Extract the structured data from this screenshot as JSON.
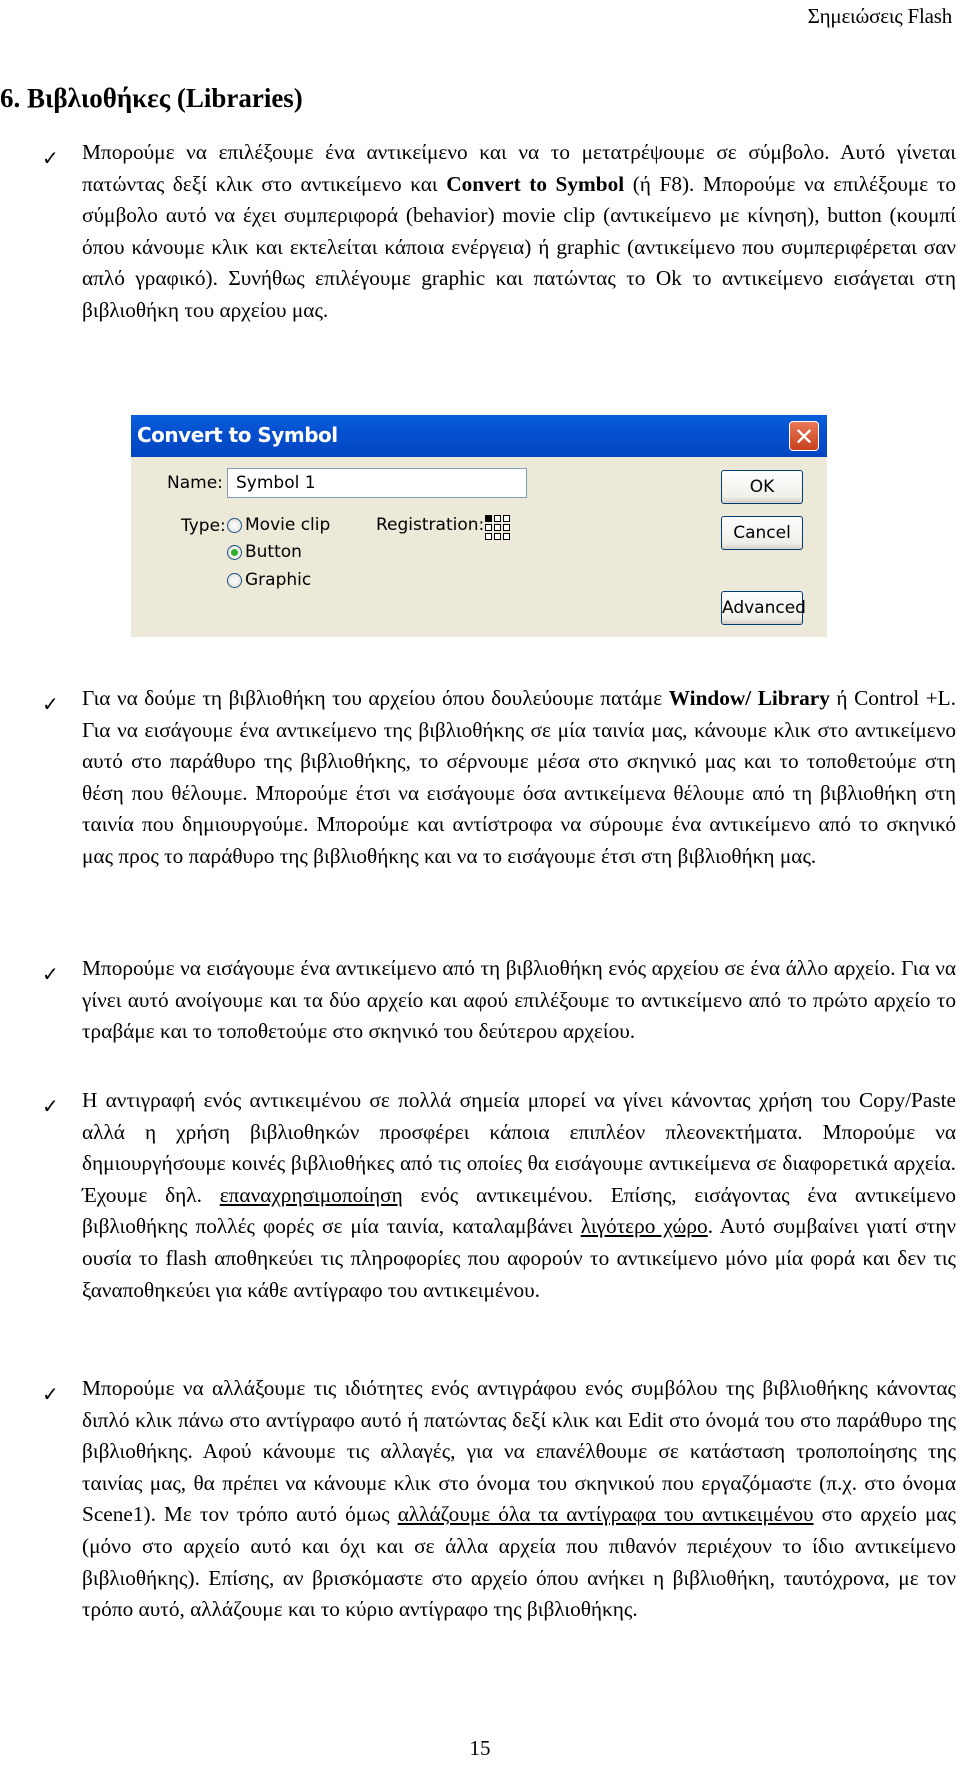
{
  "header": {
    "running_title": "Σημειώσεις Flash"
  },
  "section": {
    "title": "6. Βιβλιοθήκες (Libraries)"
  },
  "bullet_icon": "checkmark-icon",
  "paragraphs": [
    {
      "parts": [
        {
          "t": "Μπορούμε να επιλέξουμε ένα αντικείμενο και να το μετατρέψουμε σε σύμβολο. Αυτό γίνεται πατώντας δεξί κλικ στο αντικείμενο και "
        },
        {
          "t": "Convert to Symbol",
          "b": true
        },
        {
          "t": " (ή F8). Μπορούμε να επιλέξουμε το σύμβολο αυτό να έχει συμπεριφορά (behavior) movie clip (αντικείμενο με κίνηση), button (κουμπί όπου κάνουμε κλικ και εκτελείται κάποια ενέργεια) ή graphic (αντικείμενο που συμπεριφέρεται σαν απλό γραφικό). Συνήθως επιλέγουμε graphic και πατώντας το Ok το αντικείμενο εισάγεται στη βιβλιοθήκη του αρχείου μας."
        }
      ]
    },
    {
      "parts": [
        {
          "t": "Για να δούμε τη βιβλιοθήκη του αρχείου όπου δουλεύουμε πατάμε "
        },
        {
          "t": "Window/ Library",
          "b": true
        },
        {
          "t": " ή Control +L. Για να εισάγουμε ένα αντικείμενο της βιβλιοθήκης σε μία ταινία μας, κάνουμε κλικ στο αντικείμενο αυτό στο παράθυρο της βιβλιοθήκης, το σέρνουμε μέσα στο σκηνικό μας και το τοποθετούμε στη θέση που θέλουμε. Μπορούμε έτσι να εισάγουμε όσα αντικείμενα θέλουμε από τη βιβλιοθήκη στη ταινία που δημιουργούμε. Μπορούμε και αντίστροφα να σύρουμε ένα αντικείμενο από το σκηνικό μας προς το παράθυρο της βιβλιοθήκης και να το εισάγουμε έτσι στη βιβλιοθήκη μας."
        }
      ]
    },
    {
      "parts": [
        {
          "t": "Μπορούμε να εισάγουμε ένα αντικείμενο από τη βιβλιοθήκη ενός αρχείου σε ένα άλλο αρχείο. Για να γίνει αυτό ανοίγουμε και τα δύο αρχείο και αφού επιλέξουμε το αντικείμενο από το πρώτο αρχείο το τραβάμε και το τοποθετούμε στο σκηνικό του δεύτερου αρχείου."
        }
      ]
    },
    {
      "parts": [
        {
          "t": "Η αντιγραφή ενός αντικειμένου σε πολλά σημεία μπορεί να γίνει κάνοντας χρήση του Copy/Paste αλλά η χρήση βιβλιοθηκών προσφέρει κάποια επιπλέον πλεονεκτήματα. Μπορούμε να δημιουργήσουμε κοινές βιβλιοθήκες από τις οποίες θα εισάγουμε αντικείμενα σε διαφορετικά αρχεία. Έχουμε δηλ. "
        },
        {
          "t": "επαναχρησιμοποίηση",
          "u": true
        },
        {
          "t": " ενός αντικειμένου. Επίσης, εισάγοντας ένα αντικείμενο βιβλιοθήκης πολλές φορές σε μία ταινία, καταλαμβάνει "
        },
        {
          "t": "λιγότερο χώρο",
          "u": true
        },
        {
          "t": ". Αυτό συμβαίνει γιατί στην ουσία το flash αποθηκεύει τις πληροφορίες που αφορούν το αντικείμενο μόνο μία φορά και δεν τις ξαναποθηκεύει για κάθε αντίγραφο του αντικειμένου."
        }
      ]
    },
    {
      "parts": [
        {
          "t": "Μπορούμε να αλλάξουμε τις ιδιότητες ενός αντιγράφου ενός συμβόλου της βιβλιοθήκης κάνοντας διπλό κλικ πάνω στο αντίγραφο αυτό ή πατώντας δεξί κλικ και Edit στο όνομά του στο παράθυρο της βιβλιοθήκης. Αφού κάνουμε τις αλλαγές, για να επανέλθουμε σε κατάσταση τροποποίησης της ταινίας μας, θα πρέπει να κάνουμε κλικ στο όνομα του σκηνικού που εργαζόμαστε (π.χ. στο όνομα Scene1).  Με τον τρόπο αυτό όμως "
        },
        {
          "t": "αλλάζουμε όλα τα αντίγραφα του αντικειμένου",
          "u": true
        },
        {
          "t": " στο αρχείο μας (μόνο στο αρχείο αυτό και όχι και σε άλλα αρχεία που πιθανόν περιέχουν το ίδιο αντικείμενο βιβλιοθήκης). Επίσης, αν βρισκόμαστε στο αρχείο όπου ανήκει η βιβλιοθήκη, ταυτόχρονα, με τον τρόπο αυτό, αλλάζουμε και το κύριο αντίγραφο της βιβλιοθήκης."
        }
      ]
    }
  ],
  "dialog": {
    "title": "Convert to Symbol",
    "close_icon": "close-icon",
    "name_label": "Name:",
    "name_value": "Symbol 1",
    "type_label": "Type:",
    "type_options": [
      "Movie clip",
      "Button",
      "Graphic"
    ],
    "type_selected": "Button",
    "registration_label": "Registration:",
    "registration_selected": "top-left",
    "buttons": {
      "ok": "OK",
      "cancel": "Cancel",
      "advanced": "Advanced"
    },
    "colors": {
      "titlebar": "#0550d0",
      "body": "#ece9d8",
      "close": "#d4572f",
      "radio_dot": "#2fb12f"
    }
  },
  "footer": {
    "page_number": "15"
  }
}
